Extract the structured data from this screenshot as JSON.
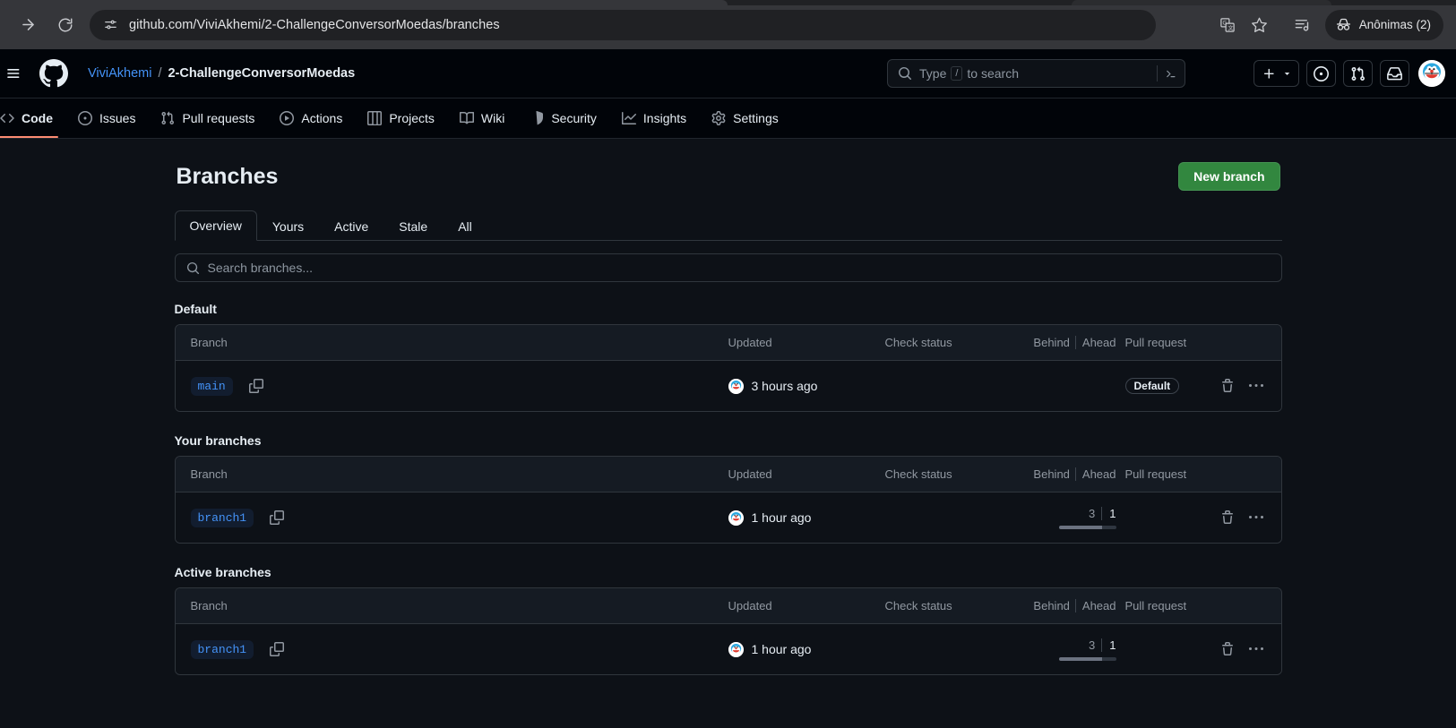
{
  "browser": {
    "url": "github.com/ViviAkhemi/2-ChallengeConversorMoedas/branches",
    "incognito_label": "Anônimas (2)",
    "icons": {
      "forward": "forward-arrow-icon",
      "reload": "reload-icon",
      "site_settings": "site-settings-icon",
      "translate": "translate-icon",
      "bookmark": "bookmark-star-icon",
      "reading_list": "reading-list-icon",
      "incognito": "incognito-icon"
    }
  },
  "gh_header": {
    "owner": "ViviAkhemi",
    "separator": "/",
    "repo": "2-ChallengeConversorMoedas",
    "search_placeholder_prefix": "Type",
    "search_slash_key": "/",
    "search_placeholder_suffix": "to search"
  },
  "repo_nav": {
    "tabs": [
      {
        "label": "Code",
        "icon": "code-icon",
        "active": true
      },
      {
        "label": "Issues",
        "icon": "issue-opened-icon",
        "active": false
      },
      {
        "label": "Pull requests",
        "icon": "git-pull-request-icon",
        "active": false
      },
      {
        "label": "Actions",
        "icon": "play-circle-icon",
        "active": false
      },
      {
        "label": "Projects",
        "icon": "table-icon",
        "active": false
      },
      {
        "label": "Wiki",
        "icon": "book-icon",
        "active": false
      },
      {
        "label": "Security",
        "icon": "shield-icon",
        "active": false
      },
      {
        "label": "Insights",
        "icon": "graph-icon",
        "active": false
      },
      {
        "label": "Settings",
        "icon": "gear-icon",
        "active": false
      }
    ]
  },
  "page": {
    "title": "Branches",
    "new_branch_label": "New branch",
    "filter_tabs": [
      {
        "label": "Overview",
        "active": true
      },
      {
        "label": "Yours",
        "active": false
      },
      {
        "label": "Active",
        "active": false
      },
      {
        "label": "Stale",
        "active": false
      },
      {
        "label": "All",
        "active": false
      }
    ],
    "search_placeholder": "Search branches...",
    "columns": {
      "branch": "Branch",
      "updated": "Updated",
      "check_status": "Check status",
      "behind": "Behind",
      "ahead": "Ahead",
      "pull_request": "Pull request"
    },
    "sections": [
      {
        "title": "Default",
        "rows": [
          {
            "name": "main",
            "updated": "3 hours ago",
            "check_status": "",
            "behind": "",
            "ahead": "",
            "pull_request": "Default",
            "pr_is_badge": true,
            "show_bar": false
          }
        ]
      },
      {
        "title": "Your branches",
        "rows": [
          {
            "name": "branch1",
            "updated": "1 hour ago",
            "check_status": "",
            "behind": "3",
            "ahead": "1",
            "pull_request": "",
            "pr_is_badge": false,
            "show_bar": true
          }
        ]
      },
      {
        "title": "Active branches",
        "rows": [
          {
            "name": "branch1",
            "updated": "1 hour ago",
            "check_status": "",
            "behind": "3",
            "ahead": "1",
            "pull_request": "",
            "pr_is_badge": false,
            "show_bar": true
          }
        ]
      }
    ],
    "row_actions": {
      "delete": "trash-icon",
      "more": "kebab-menu-icon",
      "copy": "copy-icon"
    }
  },
  "colors": {
    "page_bg": "#0d1117",
    "header_bg": "#010409",
    "accent_green": "#32873f",
    "link_blue": "#4493f8",
    "active_tab_underline": "#fd8c73",
    "border": "#30363d"
  }
}
